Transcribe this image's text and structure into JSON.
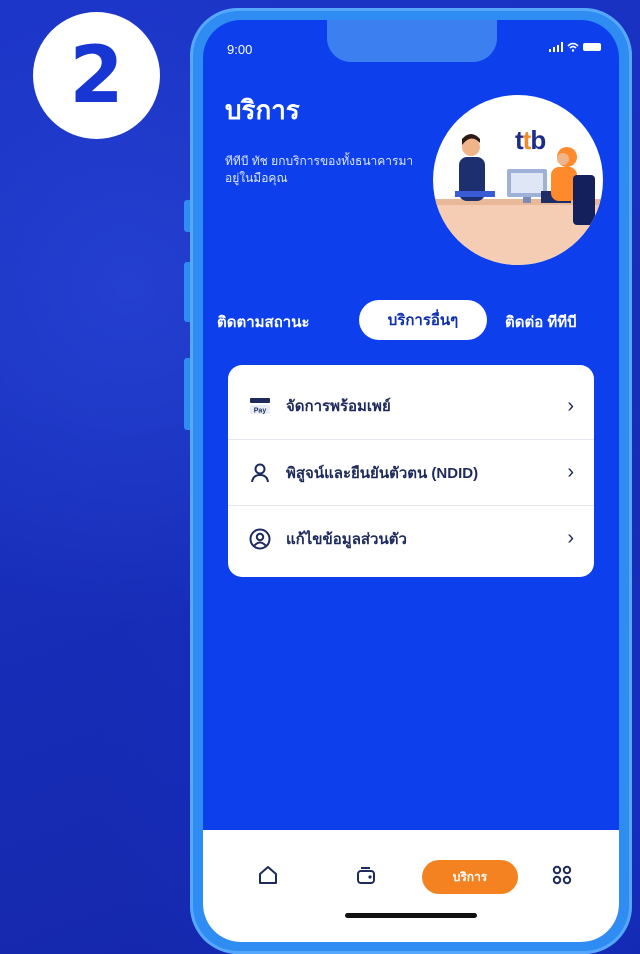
{
  "step": {
    "number": "2"
  },
  "status_bar": {
    "time": "9:00"
  },
  "header": {
    "title": "บริการ",
    "subtitle": "ทีทีบี ทัช ยกบริการของทั้งธนาคารมาอยู่ในมือคุณ",
    "brand_logo": "ttb"
  },
  "tabs": [
    {
      "label": "ติดตามสถานะ",
      "active": false
    },
    {
      "label": "บริการอื่นๆ",
      "active": true
    },
    {
      "label": "ติดต่อ ทีทีบี",
      "active": false
    }
  ],
  "menu": {
    "items": [
      {
        "label": "จัดการพร้อมเพย์",
        "icon": "promptpay-icon"
      },
      {
        "label": "พิสูจน์และยืนยันตัวตน (NDID)",
        "icon": "person-verify-icon"
      },
      {
        "label": "แก้ไขข้อมูลส่วนตัว",
        "icon": "profile-icon"
      }
    ],
    "promptpay_icon_text": "Pay"
  },
  "bottom_nav": {
    "items": [
      {
        "icon": "home-icon",
        "label": ""
      },
      {
        "icon": "wallet-icon",
        "label": ""
      },
      {
        "icon": "",
        "label": "บริการ",
        "active": true
      },
      {
        "icon": "apps-grid-icon",
        "label": ""
      }
    ]
  },
  "colors": {
    "background": "#1a2fb8",
    "screen": "#0d40ec",
    "accent": "#f58220",
    "text_dark": "#1d2a5c"
  }
}
